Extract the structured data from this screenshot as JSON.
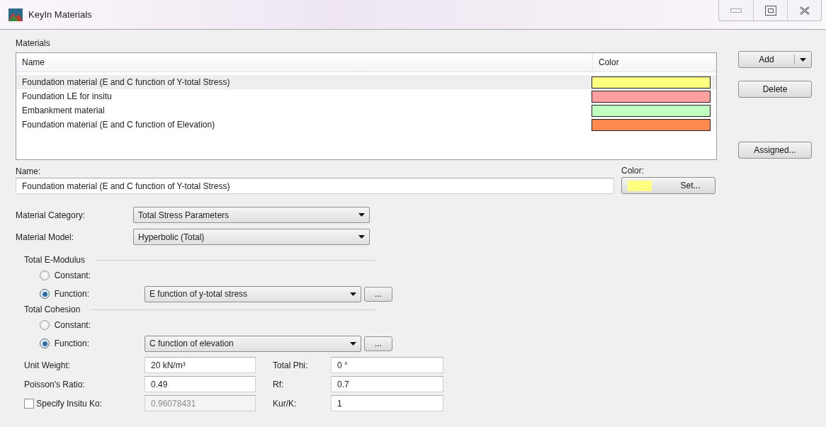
{
  "window": {
    "title": "KeyIn Materials"
  },
  "materials": {
    "label": "Materials",
    "columns": [
      "Name",
      "Color"
    ],
    "rows": [
      {
        "name": "Foundation material (E and C function of Y-total Stress)",
        "color": "#ffff80",
        "selected": true
      },
      {
        "name": "Foundation LE for insitu",
        "color": "#ffa0a0",
        "selected": false
      },
      {
        "name": "Embankment material",
        "color": "#c0ffc0",
        "selected": false
      },
      {
        "name": "Foundation material (E and C function of Elevation)",
        "color": "#ff8a50",
        "selected": false
      }
    ]
  },
  "side_buttons": [
    {
      "label": "Add",
      "kind": "split"
    },
    {
      "label": "Delete",
      "kind": "plain"
    },
    {
      "label": "Assigned...",
      "kind": "plain"
    }
  ],
  "name_field": {
    "label": "Name:",
    "value": "Foundation material (E and C function of Y-total Stress)"
  },
  "color_field": {
    "label": "Color:",
    "color": "#ffff80",
    "button": "Set..."
  },
  "selects": [
    {
      "label": "Material Category:",
      "value": "Total Stress Parameters"
    },
    {
      "label": "Material Model:",
      "value": "Hyperbolic (Total)"
    }
  ],
  "groups": [
    {
      "title": "Total E-Modulus",
      "options": [
        {
          "label": "Constant:",
          "selected": false
        },
        {
          "label": "Function:",
          "selected": true,
          "value": "E function of y-total stress",
          "button": "..."
        }
      ]
    },
    {
      "title": "Total Cohesion",
      "options": [
        {
          "label": "Constant:",
          "selected": false
        },
        {
          "label": "Function:",
          "selected": true,
          "value": "C function of elevation",
          "button": "..."
        }
      ]
    }
  ],
  "params": [
    {
      "label": "Unit Weight:",
      "value": "20 kN/m³",
      "label_2": "Total Phi:",
      "value_2": "0 °"
    },
    {
      "label": "Poisson's Ratio:",
      "value": "0.49",
      "label_2": "Rf:",
      "value_2": "0.7"
    },
    {
      "label": "Specify Insitu Ko:",
      "kind": "checkbox",
      "checked": false,
      "disabled": true,
      "value": "0.96078431",
      "label_2": "Kur/K:",
      "value_2": "1"
    }
  ]
}
